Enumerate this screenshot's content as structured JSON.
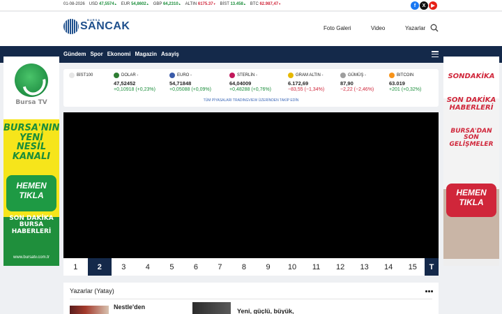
{
  "ticker": {
    "date": "01-08-2026",
    "items": [
      {
        "label": "USD",
        "value": "47,5574",
        "dir": "up"
      },
      {
        "label": "EUR",
        "value": "54,8602",
        "dir": "up"
      },
      {
        "label": "GBP",
        "value": "64,2310",
        "dir": "up"
      },
      {
        "label": "ALTIN",
        "value": "6175.37",
        "dir": "down"
      },
      {
        "label": "BİST",
        "value": "13.458",
        "dir": "up"
      },
      {
        "label": "BTC",
        "value": "62.987,47",
        "dir": "down"
      }
    ],
    "up_arrow": "▲",
    "down_arrow": "▼"
  },
  "social": {
    "facebook": {
      "icon": "facebook-icon",
      "glyph": "f",
      "color": "#1877f2"
    },
    "x": {
      "icon": "x-icon",
      "glyph": "X",
      "color": "#111111"
    },
    "youtube": {
      "icon": "youtube-icon",
      "glyph": "▶",
      "color": "#e62117"
    }
  },
  "logo": {
    "small": "BURSA",
    "big": "SANCAK"
  },
  "header_nav": [
    "Foto Galeri",
    "Video",
    "Yazarlar"
  ],
  "main_nav": {
    "items": [
      "Gündem",
      "Spor",
      "Ekonomi",
      "Magazin",
      "Asayiş"
    ]
  },
  "ad_left": {
    "lines": [
      "BURSA'NIN",
      "YENİ NESİL",
      "KANALI"
    ],
    "pill": "HEMEN TIKLA",
    "lines2": [
      "SON DAKİKA",
      "BURSA",
      "HABERLERİ"
    ],
    "url": "www.bursatv.com.tr"
  },
  "ad_right": {
    "brand": "SONDAKİKA",
    "lines": [
      "SON DAKİKA",
      "HABERLERİ"
    ],
    "lines2": [
      "BURSA'DAN SON",
      "GELİŞMELER"
    ],
    "pill": "HEMEN TIKLA"
  },
  "market": {
    "items": [
      {
        "name": "BİST100",
        "price": "",
        "change": "",
        "dir": "",
        "color": "#e6e6e6"
      },
      {
        "name": "DOLAR -",
        "price": "47,52452",
        "change": "+0,10918 (+0,23%)",
        "dir": "up",
        "color": "#2e7d32"
      },
      {
        "name": "EURO -",
        "price": "54,71848",
        "change": "+0,05088 (+0,09%)",
        "dir": "up",
        "color": "#3a5ba9"
      },
      {
        "name": "STERLİN -",
        "price": "64,04009",
        "change": "+0,48288 (+0,76%)",
        "dir": "up",
        "color": "#c2185b"
      },
      {
        "name": "GRAM ALTIN -",
        "price": "6.172,69",
        "change": "−83,55 (−1,34%)",
        "dir": "dn",
        "color": "#e6b800"
      },
      {
        "name": "GÜMÜŞ -",
        "price": "87,90",
        "change": "−2,22 (−2,46%)",
        "dir": "dn",
        "color": "#9e9e9e"
      },
      {
        "name": "BITCOIN",
        "price": "63.019",
        "change": "+201 (+0,32%)",
        "dir": "up",
        "color": "#f7931a"
      }
    ],
    "link": "TÜM PİYASALARI TRADINGVIEW ÜZERİNDEN TAKİP EDİN"
  },
  "pagination": {
    "pages": [
      "1",
      "2",
      "3",
      "4",
      "5",
      "6",
      "7",
      "8",
      "9",
      "10",
      "11",
      "12",
      "13",
      "14",
      "15"
    ],
    "active": "2",
    "last_label": "T"
  },
  "authors": {
    "title": "Yazarlar (Yatay)",
    "articles": [
      {
        "title": "Nestle'den"
      },
      {
        "title": "Yeni, güçlü, büyük,"
      }
    ]
  }
}
